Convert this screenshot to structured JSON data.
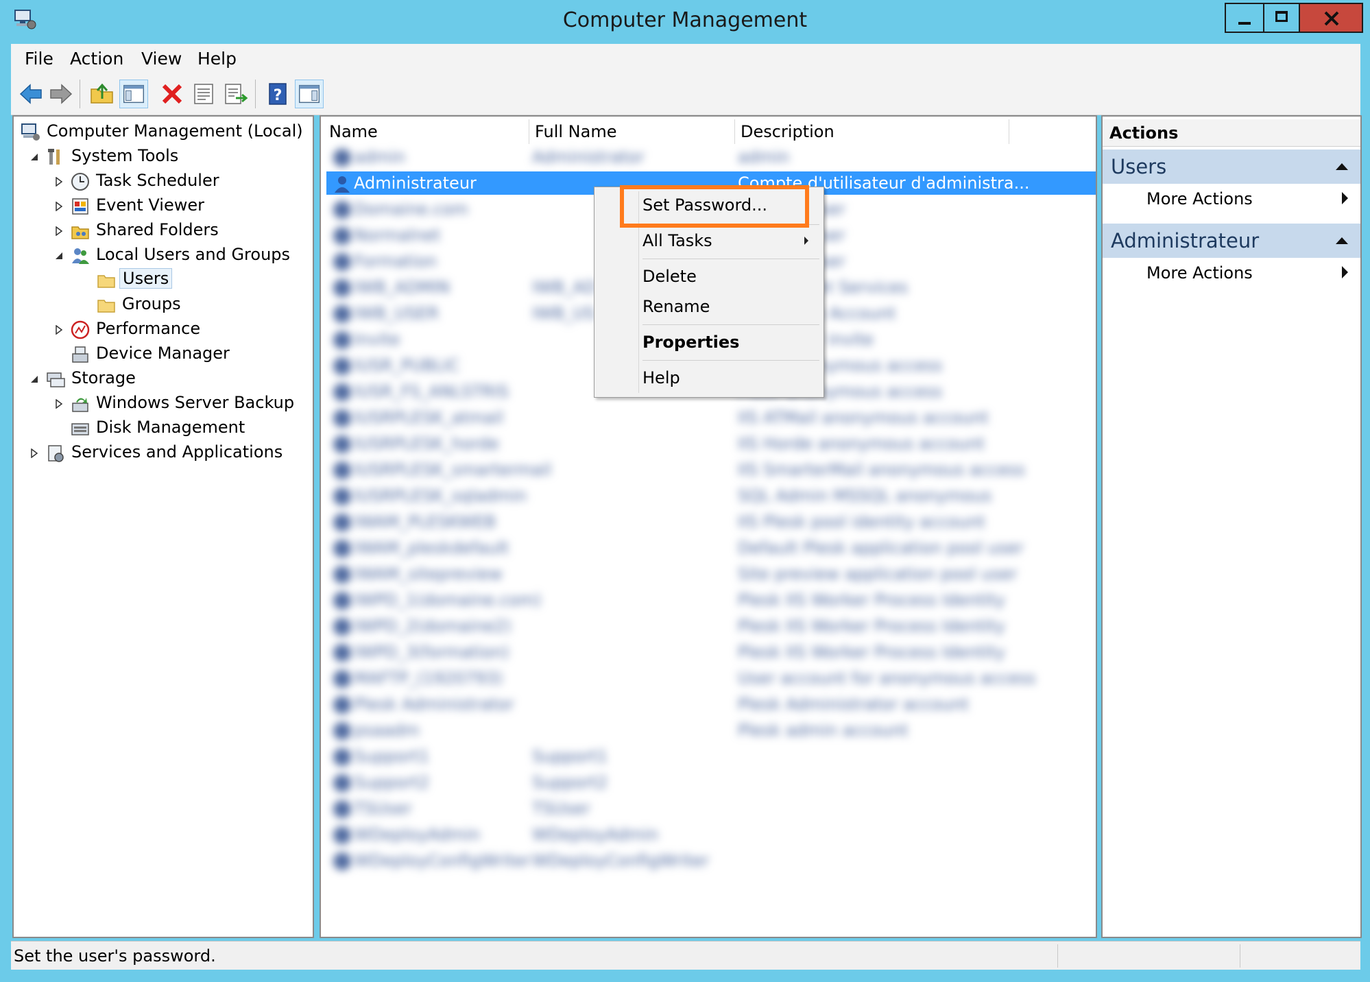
{
  "window": {
    "title": "Computer Management"
  },
  "menu": [
    "File",
    "Action",
    "View",
    "Help"
  ],
  "toolbar_icons": [
    "back-arrow-icon",
    "forward-arrow-icon",
    "up-folder-icon",
    "show-hide-console-tree-icon",
    "delete-icon",
    "properties-icon",
    "export-list-icon",
    "help-icon",
    "show-hide-action-pane-icon"
  ],
  "tree": {
    "root": "Computer Management (Local)",
    "system_tools": "System Tools",
    "task_scheduler": "Task Scheduler",
    "event_viewer": "Event Viewer",
    "shared_folders": "Shared Folders",
    "local_users_groups": "Local Users and Groups",
    "users": "Users",
    "groups": "Groups",
    "performance": "Performance",
    "device_manager": "Device Manager",
    "storage": "Storage",
    "windows_server_backup": "Windows Server Backup",
    "disk_management": "Disk Management",
    "services_applications": "Services and Applications"
  },
  "list": {
    "columns": {
      "name": "Name",
      "full_name": "Full Name",
      "description": "Description"
    },
    "selected": {
      "name": "Administrateur",
      "description": "Compte d'utilisateur d'administra..."
    }
  },
  "context_menu": {
    "set_password": "Set Password...",
    "all_tasks": "All Tasks",
    "delete": "Delete",
    "rename": "Rename",
    "properties": "Properties",
    "help": "Help"
  },
  "actions": {
    "title": "Actions",
    "group1": "Users",
    "group1_item": "More Actions",
    "group2": "Administrateur",
    "group2_item": "More Actions"
  },
  "status": "Set the user's password.",
  "colors": {
    "titlebar": "#6ccbe9",
    "selection": "#3399ff",
    "highlight": "#ff7b1c",
    "close_button": "#c7483d"
  }
}
